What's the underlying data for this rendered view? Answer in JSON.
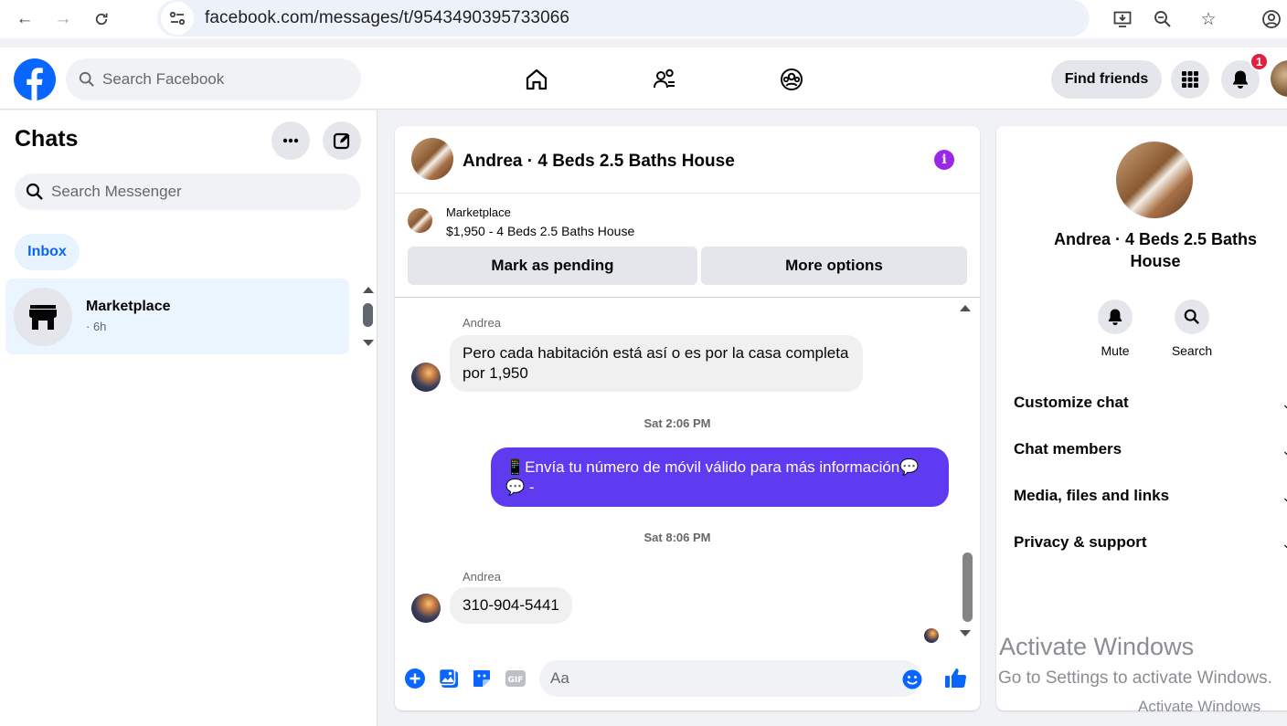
{
  "browser": {
    "url": "facebook.com/messages/t/9543490395733066"
  },
  "fb_header": {
    "search_placeholder": "Search Facebook",
    "find_friends_label": "Find friends",
    "notification_count": "1",
    "brand_color": "#0866ff"
  },
  "chats": {
    "title": "Chats",
    "search_placeholder": "Search Messenger",
    "inbox_label": "Inbox",
    "items": [
      {
        "name": "Marketplace",
        "time": "· 6h"
      }
    ]
  },
  "conversation": {
    "title": "Andrea · 4 Beds 2.5 Baths House",
    "marketplace_label": "Marketplace",
    "listing": "$1,950 - 4 Beds 2.5 Baths House",
    "mark_pending_label": "Mark as pending",
    "more_options_label": "More options",
    "messages": [
      {
        "sender": "Andrea",
        "text_line1": "Pero cada habitación está así o es por la casa completa",
        "text_line2": "por 1,950"
      },
      {
        "timestamp": "Sat 2:06 PM"
      },
      {
        "outgoing_line1": "📱Envía tu número de móvil válido para más información💬",
        "outgoing_line2": "💬 -"
      },
      {
        "timestamp": "Sat 8:06 PM"
      },
      {
        "sender": "Andrea",
        "text": "310-904-5441"
      }
    ],
    "composer_placeholder": "Aa",
    "outgoing_color": "#5e3af0"
  },
  "info_panel": {
    "name_line1": "Andrea · 4 Beds 2.5 Baths",
    "name_line2": "House",
    "mute_label": "Mute",
    "search_label": "Search",
    "rows": [
      "Customize chat",
      "Chat members",
      "Media, files and links",
      "Privacy & support"
    ]
  },
  "watermark": {
    "line1": "Activate Windows",
    "line2": "Go to Settings to activate Windows.",
    "line3": "Activate Windows"
  }
}
